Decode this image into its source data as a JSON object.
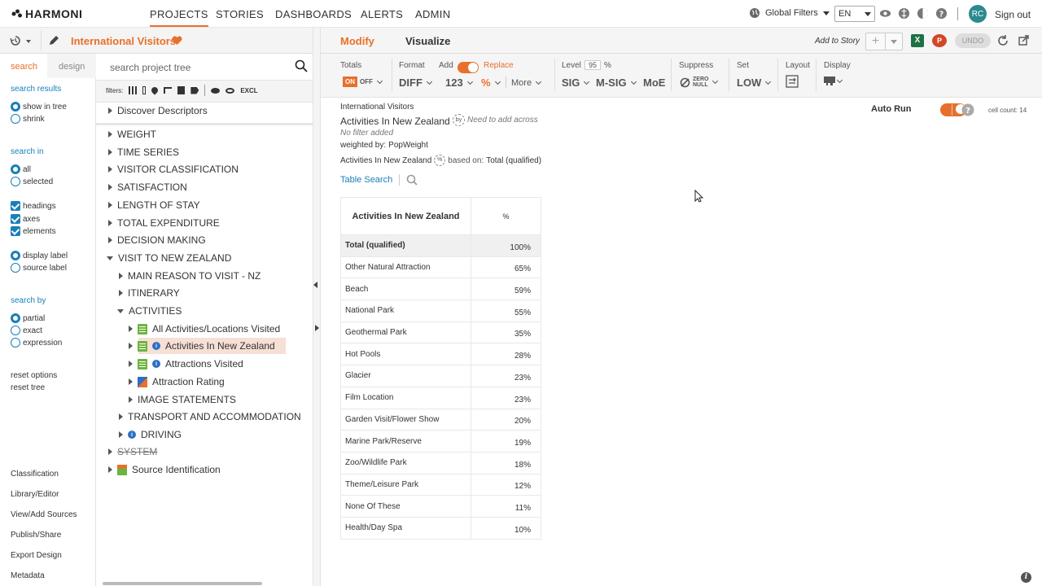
{
  "brand": "HARMONI",
  "nav": {
    "projects": "PROJECTS",
    "stories": "STORIES",
    "dashboards": "DASHBOARDS",
    "alerts": "ALERTS",
    "admin": "ADMIN"
  },
  "top_right": {
    "global_filters": "Global Filters",
    "language": "EN",
    "avatar": "RC",
    "sign_out": "Sign out"
  },
  "project": {
    "title": "International Visitors"
  },
  "left_tabs": {
    "search": "search",
    "design": "design"
  },
  "left_panel": {
    "search_results": "search results",
    "show_in_tree": "show in tree",
    "shrink": "shrink",
    "search_in": "search in",
    "all": "all",
    "selected": "selected",
    "headings": "headings",
    "axes": "axes",
    "elements": "elements",
    "display_label": "display label",
    "source_label": "source label",
    "search_by": "search by",
    "partial": "partial",
    "exact": "exact",
    "expression": "expression",
    "reset_options": "reset options",
    "reset_tree": "reset tree",
    "links": [
      "Classification",
      "Library/Editor",
      "View/Add Sources",
      "Publish/Share",
      "Export Design",
      "Metadata"
    ]
  },
  "tree": {
    "search_placeholder": "search project tree",
    "filters_label": "filters:",
    "excl": "EXCL",
    "items": [
      "Discover Descriptors",
      "WEIGHT",
      "TIME SERIES",
      "VISITOR CLASSIFICATION",
      "SATISFACTION",
      "LENGTH OF STAY",
      "TOTAL EXPENDITURE",
      "DECISION MAKING",
      "VISIT TO NEW ZEALAND",
      "MAIN REASON TO VISIT - NZ",
      "ITINERARY",
      "ACTIVITIES",
      "All Activities/Locations Visited",
      "Activities In New Zealand",
      "Attractions Visited",
      "Attraction Rating",
      "IMAGE STATEMENTS",
      "TRANSPORT AND ACCOMMODATION",
      "DRIVING",
      "SYSTEM",
      "Source Identification"
    ]
  },
  "mode_tabs": {
    "modify": "Modify",
    "visualize": "Visualize"
  },
  "story": {
    "add_to_story": "Add to Story",
    "undo": "UNDO"
  },
  "options": {
    "totals": "Totals",
    "on": "ON",
    "off": "OFF",
    "format": "Format",
    "add": "Add",
    "replace": "Replace",
    "diff": "DIFF",
    "num": "123",
    "pct": "%",
    "more": "More",
    "level": "Level",
    "level_val": "95",
    "level_pct": "%",
    "sig": "SIG",
    "msig": "M-SIG",
    "moe": "MoE",
    "suppress": "Suppress",
    "zero": "ZERO",
    "null": "NULL",
    "set": "Set",
    "low": "LOW",
    "layout": "Layout",
    "display": "Display"
  },
  "report": {
    "source": "International Visitors",
    "title": "Activities In New Zealand",
    "by": "by",
    "need_across": "Need to add across",
    "no_filter": "No filter added",
    "weighted_by_label": "weighted by:",
    "weighted_by": "PopWeight",
    "base_var": "Activities In New Zealand",
    "base_pct": "%",
    "based_on_label": "based on:",
    "based_on": "Total (qualified)",
    "table_search": "Table Search",
    "auto_run": "Auto Run",
    "cell_count": "cell count: 14"
  },
  "table": {
    "header": [
      "Activities In New Zealand",
      "%"
    ],
    "total": {
      "label": "Total (qualified)",
      "value": "100%"
    },
    "rows": [
      {
        "label": "Other Natural Attraction",
        "value": "65%"
      },
      {
        "label": "Beach",
        "value": "59%"
      },
      {
        "label": "National Park",
        "value": "55%"
      },
      {
        "label": "Geothermal Park",
        "value": "35%"
      },
      {
        "label": "Hot Pools",
        "value": "28%"
      },
      {
        "label": "Glacier",
        "value": "23%"
      },
      {
        "label": "Film Location",
        "value": "23%"
      },
      {
        "label": "Garden Visit/Flower Show",
        "value": "20%"
      },
      {
        "label": "Marine Park/Reserve",
        "value": "19%"
      },
      {
        "label": "Zoo/Wildlife Park",
        "value": "18%"
      },
      {
        "label": "Theme/Leisure Park",
        "value": "12%"
      },
      {
        "label": "None Of These",
        "value": "11%"
      },
      {
        "label": "Health/Day Spa",
        "value": "10%"
      }
    ]
  },
  "colors": {
    "accent": "#e8702a",
    "link": "#1a7fb8",
    "avatar": "#2a8b8f"
  }
}
